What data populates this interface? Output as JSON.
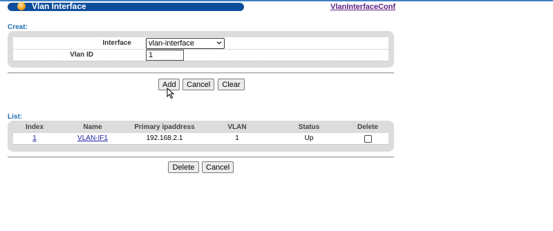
{
  "header": {
    "title": "Vlan Interface",
    "conf_link": "VlanInterfaceConf"
  },
  "creat": {
    "label": "Creat:",
    "interface_label": "Interface",
    "interface_value": "vlan-interface",
    "vlan_id_label": "Vlan ID",
    "vlan_id_value": "1"
  },
  "form_buttons": {
    "add": "Add",
    "cancel": "Cancel",
    "clear": "Clear"
  },
  "list": {
    "label": "List:",
    "columns": [
      "Index",
      "Name",
      "Primary ipaddress",
      "VLAN",
      "Status",
      "Delete"
    ],
    "rows": [
      {
        "index": "1",
        "name": "VLAN-IF1",
        "ip": "192.168.2.1",
        "vlan": "1",
        "status": "Up",
        "delete_checked": false
      }
    ]
  },
  "list_buttons": {
    "delete": "Delete",
    "cancel": "Cancel"
  },
  "icons": {
    "title": "orb-icon",
    "dropdown": "chevron-down-icon",
    "cursor": "mouse-pointer-icon"
  },
  "colors": {
    "title_bar": "#0d4d9c",
    "section_label": "#1f6fb2",
    "conf_link": "#5a1f80",
    "link": "#1a1aa8",
    "panel": "#dcdcdc"
  }
}
